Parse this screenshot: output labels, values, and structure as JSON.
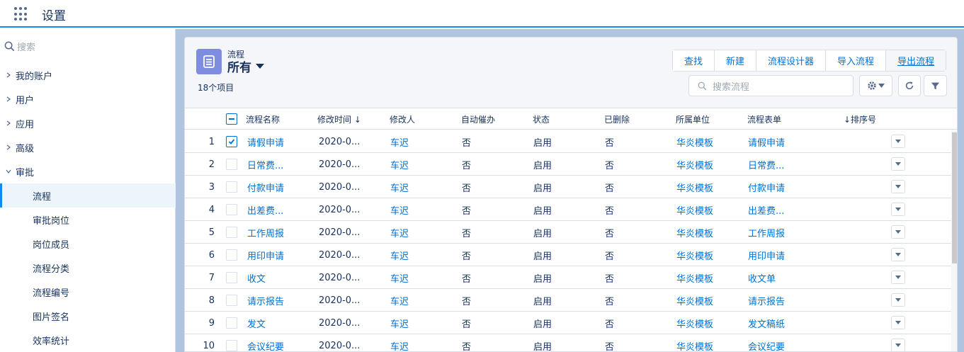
{
  "app": {
    "title": "设置"
  },
  "sidebar": {
    "search_placeholder": "搜索",
    "items": [
      {
        "label": "我的账户"
      },
      {
        "label": "用户"
      },
      {
        "label": "应用"
      },
      {
        "label": "高级"
      },
      {
        "label": "审批"
      }
    ],
    "sub_items": [
      {
        "label": "流程"
      },
      {
        "label": "审批岗位"
      },
      {
        "label": "岗位成员"
      },
      {
        "label": "流程分类"
      },
      {
        "label": "流程编号"
      },
      {
        "label": "图片签名"
      },
      {
        "label": "效率统计"
      }
    ]
  },
  "list": {
    "object_type": "流程",
    "view_name": "所有",
    "item_count": "18个项目",
    "search_placeholder": "搜索流程",
    "buttons": [
      "查找",
      "新建",
      "流程设计器",
      "导入流程",
      "导出流程"
    ]
  },
  "table": {
    "columns": [
      "流程名称",
      "修改时间 ↓",
      "修改人",
      "自动催办",
      "状态",
      "已删除",
      "所属单位",
      "流程表单",
      "↓排序号"
    ],
    "rows": [
      {
        "num": "1",
        "name": "请假申请",
        "time": "2020-0...",
        "modifier": "车迟",
        "auto": "否",
        "status": "启用",
        "deleted": "否",
        "unit": "华炎模板",
        "form": "请假申请",
        "checked": true
      },
      {
        "num": "2",
        "name": "日常费...",
        "time": "2020-0...",
        "modifier": "车迟",
        "auto": "否",
        "status": "启用",
        "deleted": "否",
        "unit": "华炎模板",
        "form": "日常费...",
        "checked": false
      },
      {
        "num": "3",
        "name": "付款申请",
        "time": "2020-0...",
        "modifier": "车迟",
        "auto": "否",
        "status": "启用",
        "deleted": "否",
        "unit": "华炎模板",
        "form": "付款申请",
        "checked": false
      },
      {
        "num": "4",
        "name": "出差费...",
        "time": "2020-0...",
        "modifier": "车迟",
        "auto": "否",
        "status": "启用",
        "deleted": "否",
        "unit": "华炎模板",
        "form": "出差费...",
        "checked": false
      },
      {
        "num": "5",
        "name": "工作周报",
        "time": "2020-0...",
        "modifier": "车迟",
        "auto": "否",
        "status": "启用",
        "deleted": "否",
        "unit": "华炎模板",
        "form": "工作周报",
        "checked": false
      },
      {
        "num": "6",
        "name": "用印申请",
        "time": "2020-0...",
        "modifier": "车迟",
        "auto": "否",
        "status": "启用",
        "deleted": "否",
        "unit": "华炎模板",
        "form": "用印申请",
        "checked": false
      },
      {
        "num": "7",
        "name": "收文",
        "time": "2020-0...",
        "modifier": "车迟",
        "auto": "否",
        "status": "启用",
        "deleted": "否",
        "unit": "华炎模板",
        "form": "收文单",
        "checked": false
      },
      {
        "num": "8",
        "name": "请示报告",
        "time": "2020-0...",
        "modifier": "车迟",
        "auto": "否",
        "status": "启用",
        "deleted": "否",
        "unit": "华炎模板",
        "form": "请示报告",
        "checked": false
      },
      {
        "num": "9",
        "name": "发文",
        "time": "2020-0...",
        "modifier": "车迟",
        "auto": "否",
        "status": "启用",
        "deleted": "否",
        "unit": "华炎模板",
        "form": "发文稿纸",
        "checked": false
      },
      {
        "num": "10",
        "name": "会议纪要",
        "time": "2020-0...",
        "modifier": "车迟",
        "auto": "否",
        "status": "启用",
        "deleted": "否",
        "unit": "华炎模板",
        "form": "会议纪要",
        "checked": false
      }
    ]
  },
  "colors": {
    "accent": "#1589ee",
    "link": "#0070d2",
    "list_icon": "#7f8de1",
    "page_bg": "#b0c4df"
  }
}
